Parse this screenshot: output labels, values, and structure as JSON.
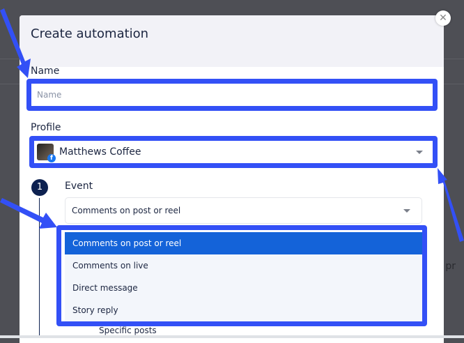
{
  "modal": {
    "title": "Create automation",
    "close_icon": "close-icon"
  },
  "name": {
    "label": "Name",
    "placeholder": "Name",
    "value": ""
  },
  "profile": {
    "label": "Profile",
    "value": "Matthews Coffee",
    "network": "facebook"
  },
  "step": {
    "number": "1",
    "label": "Event"
  },
  "event": {
    "selected": "Comments on post or reel",
    "options": [
      {
        "label": "Comments on post or reel",
        "selected": true
      },
      {
        "label": "Comments on live"
      },
      {
        "label": "Direct message"
      },
      {
        "label": "Story reply"
      }
    ]
  },
  "behind": {
    "partial_option": "Specific posts",
    "partial_text": "d pr"
  },
  "colors": {
    "annotation": "#3350f6",
    "highlight": "#1463d9",
    "step": "#0d2150"
  }
}
